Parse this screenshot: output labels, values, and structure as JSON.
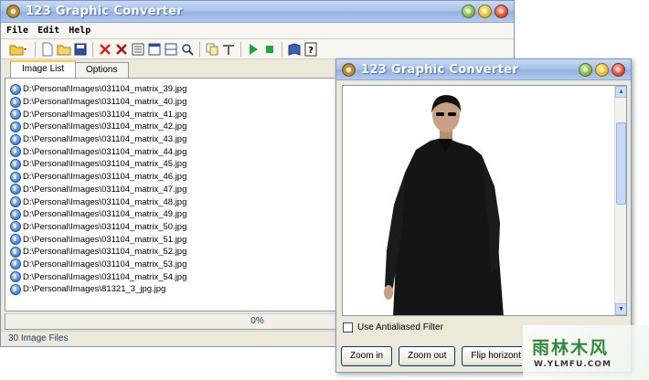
{
  "main_window": {
    "title": "123 Graphic Converter",
    "menu": [
      "File",
      "Edit",
      "Help"
    ],
    "tabs": [
      {
        "label": "Image List",
        "active": true
      },
      {
        "label": "Options",
        "active": false
      }
    ],
    "files": [
      "D:\\Personal\\Images\\031104_matrix_39.jpg",
      "D:\\Personal\\Images\\031104_matrix_40.jpg",
      "D:\\Personal\\Images\\031104_matrix_41.jpg",
      "D:\\Personal\\Images\\031104_matrix_42.jpg",
      "D:\\Personal\\Images\\031104_matrix_43.jpg",
      "D:\\Personal\\Images\\031104_matrix_44.jpg",
      "D:\\Personal\\Images\\031104_matrix_45.jpg",
      "D:\\Personal\\Images\\031104_matrix_46.jpg",
      "D:\\Personal\\Images\\031104_matrix_47.jpg",
      "D:\\Personal\\Images\\031104_matrix_48.jpg",
      "D:\\Personal\\Images\\031104_matrix_49.jpg",
      "D:\\Personal\\Images\\031104_matrix_50.jpg",
      "D:\\Personal\\Images\\031104_matrix_51.jpg",
      "D:\\Personal\\Images\\031104_matrix_52.jpg",
      "D:\\Personal\\Images\\031104_matrix_53.jpg",
      "D:\\Personal\\Images\\031104_matrix_54.jpg",
      "D:\\Personal\\Images\\81321_3_jpg.jpg"
    ],
    "progress": {
      "label": "0%",
      "fraction": 0
    },
    "status": "30 Image Files"
  },
  "toolbar_icons": [
    "open-folder-icon",
    "new-file-icon",
    "open-icon",
    "save-icon",
    "remove-icon",
    "remove-all-icon",
    "list-view-icon",
    "window-icon",
    "split-view-icon",
    "zoom-icon",
    "copy-icon",
    "tools-icon",
    "play-icon",
    "stop-icon",
    "book-icon",
    "help-icon"
  ],
  "preview_window": {
    "title": "123 Graphic Converter",
    "antialias_label": "Use Antialiased Filter",
    "antialias_checked": false,
    "buttons": {
      "zoom_in": "Zoom in",
      "zoom_out": "Zoom out",
      "flip": "Flip horizont"
    }
  },
  "watermark": {
    "main": "雨林木风",
    "sub": "W.YLMFU.COM"
  },
  "colors": {
    "title_gradient": "#a9c3ea",
    "panel_bg": "#ece9d8",
    "tab_accent": "#ffc83c",
    "status_text": "#1d3d73",
    "watermark_green": "#2e8a3a"
  }
}
